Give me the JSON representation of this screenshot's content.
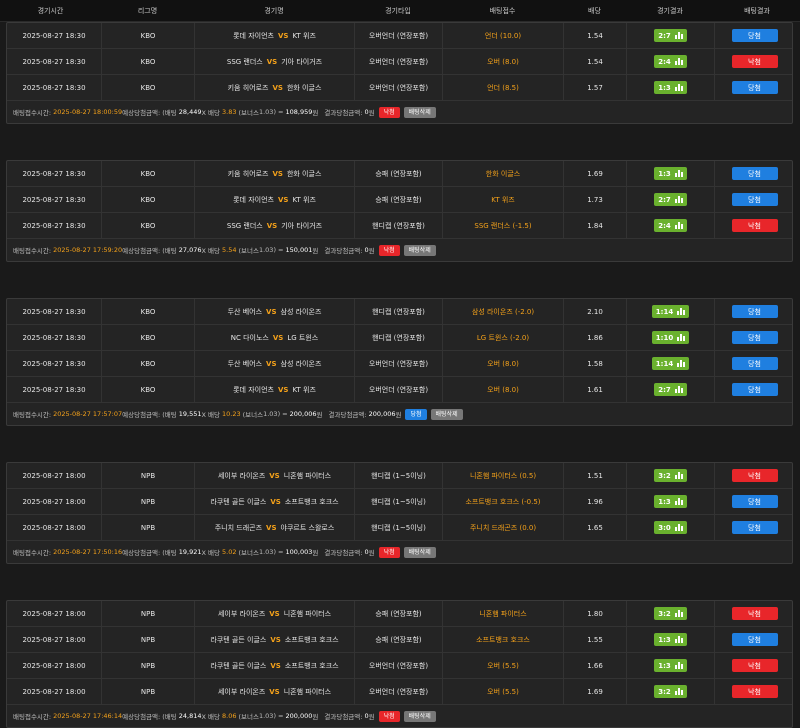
{
  "header": {
    "time": "경기시간",
    "league": "리그명",
    "game": "경기명",
    "type": "경기타입",
    "pick": "배팅접수",
    "odds": "배당",
    "score": "경기결과",
    "result": "배팅결과"
  },
  "labels": {
    "vs": "VS",
    "bet_time": "배팅접수시간:",
    "expected": "예상당첨금액: (배팅",
    "times": "X 배당",
    "bonus_open": "(보너스",
    "bonus_close": ")",
    "equals": ") =",
    "won": "원",
    "final": "결과당첨금액:",
    "delete": "배팅삭제"
  },
  "groups": [
    {
      "rows": [
        {
          "time": "2025-08-27 18:30",
          "league": "KBO",
          "home": "롯데 자이언츠",
          "away": "KT 위즈",
          "type": "오버언더 (연장포함)",
          "pick": "언더 (10.0)",
          "odds": "1.54",
          "score": "2:7",
          "result": "당첨",
          "win": true
        },
        {
          "time": "2025-08-27 18:30",
          "league": "KBO",
          "home": "SSG 랜더스",
          "away": "기아 타이거즈",
          "type": "오버언더 (연장포함)",
          "pick": "오버 (8.0)",
          "odds": "1.54",
          "score": "2:4",
          "result": "낙첨",
          "win": false
        },
        {
          "time": "2025-08-27 18:30",
          "league": "KBO",
          "home": "키움 히어로즈",
          "away": "한화 이글스",
          "type": "오버언더 (연장포함)",
          "pick": "언더 (8.5)",
          "odds": "1.57",
          "score": "1:3",
          "result": "당첨",
          "win": true
        }
      ],
      "footer": {
        "time": "2025-08-27 18:00:59",
        "stake": "28,449",
        "total_odds": "3.83",
        "bonus": "1.03",
        "expected": "108,959",
        "final": "0",
        "status": "낙첨",
        "win": false
      }
    },
    {
      "rows": [
        {
          "time": "2025-08-27 18:30",
          "league": "KBO",
          "home": "키움 히어로즈",
          "away": "한화 이글스",
          "type": "승패 (연장포함)",
          "pick": "한화 이글스",
          "odds": "1.69",
          "score": "1:3",
          "result": "당첨",
          "win": true
        },
        {
          "time": "2025-08-27 18:30",
          "league": "KBO",
          "home": "롯데 자이언츠",
          "away": "KT 위즈",
          "type": "승패 (연장포함)",
          "pick": "KT 위즈",
          "odds": "1.73",
          "score": "2:7",
          "result": "당첨",
          "win": true
        },
        {
          "time": "2025-08-27 18:30",
          "league": "KBO",
          "home": "SSG 랜더스",
          "away": "기아 타이거즈",
          "type": "핸디캡 (연장포함)",
          "pick": "SSG 랜더스 (-1.5)",
          "odds": "1.84",
          "score": "2:4",
          "result": "낙첨",
          "win": false
        }
      ],
      "footer": {
        "time": "2025-08-27 17:59:20",
        "stake": "27,076",
        "total_odds": "5.54",
        "bonus": "1.03",
        "expected": "150,001",
        "final": "0",
        "status": "낙첨",
        "win": false
      }
    },
    {
      "rows": [
        {
          "time": "2025-08-27 18:30",
          "league": "KBO",
          "home": "두산 베어스",
          "away": "삼성 라이온즈",
          "type": "핸디캡 (연장포함)",
          "pick": "삼성 라이온즈 (-2.0)",
          "odds": "2.10",
          "score": "1:14",
          "result": "당첨",
          "win": true
        },
        {
          "time": "2025-08-27 18:30",
          "league": "KBO",
          "home": "NC 다이노스",
          "away": "LG 트윈스",
          "type": "핸디캡 (연장포함)",
          "pick": "LG 트윈스 (-2.0)",
          "odds": "1.86",
          "score": "1:10",
          "result": "당첨",
          "win": true
        },
        {
          "time": "2025-08-27 18:30",
          "league": "KBO",
          "home": "두산 베어스",
          "away": "삼성 라이온즈",
          "type": "오버언더 (연장포함)",
          "pick": "오버 (8.0)",
          "odds": "1.58",
          "score": "1:14",
          "result": "당첨",
          "win": true
        },
        {
          "time": "2025-08-27 18:30",
          "league": "KBO",
          "home": "롯데 자이언츠",
          "away": "KT 위즈",
          "type": "오버언더 (연장포함)",
          "pick": "오버 (8.0)",
          "odds": "1.61",
          "score": "2:7",
          "result": "당첨",
          "win": true
        }
      ],
      "footer": {
        "time": "2025-08-27 17:57:07",
        "stake": "19,551",
        "total_odds": "10.23",
        "bonus": "1.03",
        "expected": "200,006",
        "final": "200,006",
        "status": "당첨",
        "win": true
      }
    },
    {
      "rows": [
        {
          "time": "2025-08-27 18:00",
          "league": "NPB",
          "home": "세이부 라이온즈",
          "away": "니혼햄 파이터스",
          "type": "핸디캡 (1~5이닝)",
          "pick": "니혼햄 파이터스 (0.5)",
          "odds": "1.51",
          "score": "3:2",
          "result": "낙첨",
          "win": false
        },
        {
          "time": "2025-08-27 18:00",
          "league": "NPB",
          "home": "라쿠텐 골든 이글스",
          "away": "소프트뱅크 호크스",
          "type": "핸디캡 (1~5이닝)",
          "pick": "소프트뱅크 호크스 (-0.5)",
          "odds": "1.96",
          "score": "1:3",
          "result": "당첨",
          "win": true
        },
        {
          "time": "2025-08-27 18:00",
          "league": "NPB",
          "home": "주니치 드래곤즈",
          "away": "야쿠르트 스왈로스",
          "type": "핸디캡 (1~5이닝)",
          "pick": "주니치 드래곤즈 (0.0)",
          "odds": "1.65",
          "score": "3:0",
          "result": "당첨",
          "win": true
        }
      ],
      "footer": {
        "time": "2025-08-27 17:50:16",
        "stake": "19,921",
        "total_odds": "5.02",
        "bonus": "1.03",
        "expected": "100,003",
        "final": "0",
        "status": "낙첨",
        "win": false
      }
    },
    {
      "rows": [
        {
          "time": "2025-08-27 18:00",
          "league": "NPB",
          "home": "세이부 라이온즈",
          "away": "니혼햄 파이터스",
          "type": "승패 (연장포함)",
          "pick": "니혼햄 파이터스",
          "odds": "1.80",
          "score": "3:2",
          "result": "낙첨",
          "win": false
        },
        {
          "time": "2025-08-27 18:00",
          "league": "NPB",
          "home": "라쿠텐 골든 이글스",
          "away": "소프트뱅크 호크스",
          "type": "승패 (연장포함)",
          "pick": "소프트뱅크 호크스",
          "odds": "1.55",
          "score": "1:3",
          "result": "당첨",
          "win": true
        },
        {
          "time": "2025-08-27 18:00",
          "league": "NPB",
          "home": "라쿠텐 골든 이글스",
          "away": "소프트뱅크 호크스",
          "type": "오버언더 (연장포함)",
          "pick": "오버 (5.5)",
          "odds": "1.66",
          "score": "1:3",
          "result": "낙첨",
          "win": false
        },
        {
          "time": "2025-08-27 18:00",
          "league": "NPB",
          "home": "세이부 라이온즈",
          "away": "니혼햄 파이터스",
          "type": "오버언더 (연장포함)",
          "pick": "오버 (5.5)",
          "odds": "1.69",
          "score": "3:2",
          "result": "낙첨",
          "win": false
        }
      ],
      "footer": {
        "time": "2025-08-27 17:46:14",
        "stake": "24,814",
        "total_odds": "8.06",
        "bonus": "1.03",
        "expected": "200,000",
        "final": "0",
        "status": "낙첨",
        "win": false
      }
    }
  ],
  "colors": {
    "win": "#1f7fe0",
    "lose": "#e8262a",
    "score": "#6ab12e",
    "accent": "#f5a21a"
  },
  "icons": {
    "score_chart": "bar-chart-icon"
  }
}
